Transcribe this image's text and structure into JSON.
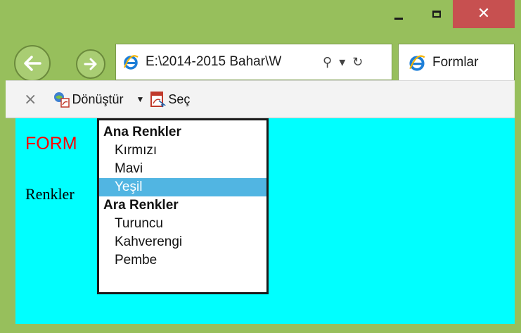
{
  "window": {
    "close_glyph": "✕"
  },
  "address": {
    "text": "E:\\2014-2015 Bahar\\W",
    "search_glyph": "⚲",
    "dropdown_glyph": "▾",
    "refresh_glyph": "↻"
  },
  "tab": {
    "label": "Formlar"
  },
  "commandbar": {
    "close_glyph": "×",
    "convert_label": "Dönüştür",
    "select_label": "Seç"
  },
  "page": {
    "title": "FORM",
    "field_label": "Renkler"
  },
  "select": {
    "groups": [
      {
        "label": "Ana Renkler",
        "options": [
          "Kırmızı",
          "Mavi",
          "Yeşil"
        ]
      },
      {
        "label": "Ara Renkler",
        "options": [
          "Turuncu",
          "Kahverengi",
          "Pembe"
        ]
      }
    ],
    "selected": "Yeşil"
  },
  "colors": {
    "frame": "#97bf5c",
    "content_bg": "#00ffff",
    "title_red": "#ff0000",
    "selection": "#51b5e2",
    "close_btn": "#c75050"
  },
  "icons": {
    "back": "arrow-left-icon",
    "forward": "arrow-right-icon",
    "ie": "internet-explorer-icon",
    "convert": "pdf-convert-icon",
    "select": "pdf-select-icon"
  }
}
